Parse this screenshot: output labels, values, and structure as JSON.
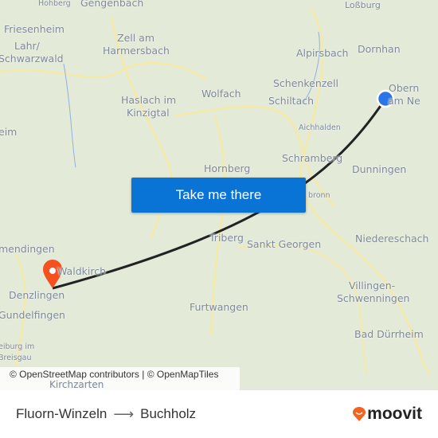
{
  "map": {
    "labels": [
      "Hohberg",
      "Gengenbach",
      "Loßburg",
      "Friesenheim",
      "Lahr/",
      "Schwarzwald",
      "Zell am",
      "Harmersbach",
      "Alpirsbach",
      "Dornhan",
      "Schenkenzell",
      "Obern",
      "am Ne",
      "Wolfach",
      "Schiltach",
      "Haslach im",
      "Kinzigtal",
      "eim",
      "Aichhalden",
      "Schramberg",
      "Dunningen",
      "Hornberg",
      "bronn",
      "Triberg",
      "Sankt Georgen",
      "Niedereschach",
      "mendingen",
      "Waldkirch",
      "Denzlingen",
      "Villingen-",
      "Schwenningen",
      "Furtwangen",
      "Gundelfingen",
      "Bad Dürrheim",
      "eiburg im",
      "Breisgau",
      "Kirchzarten"
    ],
    "origin_color": "#2a73e8",
    "destination_color": "#f4511e",
    "route_color": "#222222",
    "attribution": "© OpenStreetMap contributors | © OpenMapTiles"
  },
  "cta": {
    "label": "Take me there",
    "color": "#0a74d6"
  },
  "footer": {
    "origin": "Fluorn-Winzeln",
    "destination": "Buchholz",
    "arrow_icon": "arrow-right-icon",
    "brand": "moovit",
    "brand_color": "#f4621f"
  }
}
